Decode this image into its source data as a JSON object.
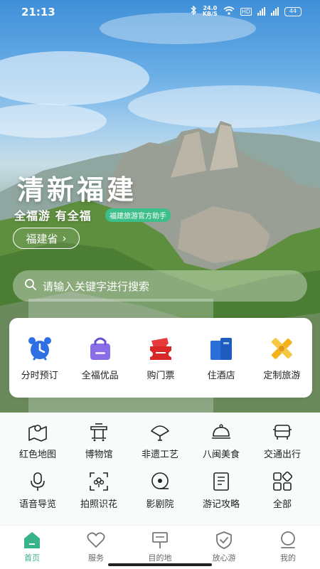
{
  "status_bar": {
    "time": "21:13",
    "net_speed_value": "24.0",
    "net_speed_unit": "KB/S",
    "hd": "HD",
    "battery": "44"
  },
  "hero": {
    "title": "清新福建",
    "subtitle": "全福游 有全福",
    "badge": "福建旅游官方助手",
    "province_button": "福建省",
    "province_chevron": "›"
  },
  "search": {
    "placeholder": "请输入关键字进行搜索"
  },
  "primary_services": [
    {
      "label": "分时预订",
      "icon": "alarm-clock-icon",
      "color": "#2f6fe4"
    },
    {
      "label": "全福优品",
      "icon": "shopping-bag-icon",
      "color": "#8a6ee8"
    },
    {
      "label": "购门票",
      "icon": "ticket-icon",
      "color": "#e53b3b"
    },
    {
      "label": "住酒店",
      "icon": "hotel-icon",
      "color": "#2a6fd8"
    },
    {
      "label": "定制旅游",
      "icon": "custom-tour-icon",
      "color": "#f2b21a"
    }
  ],
  "secondary_services": [
    {
      "label": "红色地图",
      "icon": "map-icon"
    },
    {
      "label": "博物馆",
      "icon": "museum-icon"
    },
    {
      "label": "非遗工艺",
      "icon": "fan-icon"
    },
    {
      "label": "八闽美食",
      "icon": "cloche-icon"
    },
    {
      "label": "交通出行",
      "icon": "car-icon"
    },
    {
      "label": "语音导览",
      "icon": "microphone-icon"
    },
    {
      "label": "拍照识花",
      "icon": "camera-flower-icon"
    },
    {
      "label": "影剧院",
      "icon": "film-reel-icon"
    },
    {
      "label": "游记攻略",
      "icon": "notebook-icon"
    },
    {
      "label": "全部",
      "icon": "all-apps-icon"
    }
  ],
  "bottom_nav": [
    {
      "label": "首页",
      "icon": "home-icon",
      "active": true
    },
    {
      "label": "服务",
      "icon": "heart-icon",
      "active": false
    },
    {
      "label": "目的地",
      "icon": "signpost-icon",
      "active": false
    },
    {
      "label": "放心游",
      "icon": "shield-check-icon",
      "active": false
    },
    {
      "label": "我的",
      "icon": "profile-icon",
      "active": false
    }
  ],
  "colors": {
    "accent": "#38b48b",
    "badge": "#3cbf8a"
  }
}
